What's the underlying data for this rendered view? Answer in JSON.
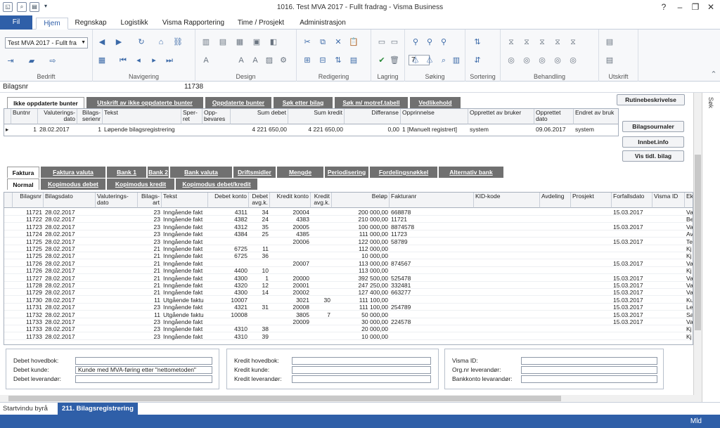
{
  "window": {
    "title": "1016. Test MVA 2017 - Fullt fradrag - Visma Business"
  },
  "ribbon_tabs": [
    "Fil",
    "Hjem",
    "Regnskap",
    "Logistikk",
    "Visma Rapportering",
    "Time / Prosjekt",
    "Administrasjon"
  ],
  "ribbon": {
    "company_select": "Test MVA 2017 - Fullt fra",
    "font_size": "7",
    "groups": [
      "Bedrift",
      "Navigering",
      "Design",
      "Redigering",
      "Lagring",
      "Søking",
      "Sortering",
      "Behandling",
      "Utskrift"
    ]
  },
  "bilagsnr": {
    "label": "Bilagsnr",
    "value": "11738"
  },
  "top_tabs": [
    "Ikke oppdaterte bunter",
    "Utskrift av ikke oppdaterte bunter",
    "Oppdaterte bunter",
    "Søk etter bilag",
    "Søk m/ motref.tabell",
    "Vedlikehold"
  ],
  "rutine_button": "Rutinebeskrivelse",
  "batch_grid": {
    "headers": [
      "Buntnr",
      "Valuterings-\ndato",
      "Bilags-\nserienr",
      "Tekst",
      "Sper-\nret",
      "Opp-\nbevares",
      "Sum debet",
      "Sum kredit",
      "Differanse",
      "Opprinnelse",
      "Opprettet av bruker",
      "Opprettet\ndato",
      "Endret av bruk"
    ],
    "row": [
      "1",
      "28.02.2017",
      "1",
      "Løpende bilagsregistrering",
      "",
      "",
      "4 221 650,00",
      "4 221 650,00",
      "0,00",
      "1 [Manuelt registrert]",
      "system",
      "09.06.2017",
      "system"
    ]
  },
  "side_buttons": [
    "Bilagsournaler",
    "Innbet.info",
    "Vis tidl. bilag"
  ],
  "mid_tabs": [
    "Faktura",
    "Faktura valuta",
    "Bank 1",
    "Bank 2",
    "Bank valuta",
    "Driftsmidler",
    "Mengde",
    "Periodisering",
    "Fordelingsnøkkel",
    "Alternativ bank"
  ],
  "sub_tabs": [
    "Normal",
    "Kopimodus debet",
    "Kopimodus kredit",
    "Kopimodus debet/kredit"
  ],
  "voucher_grid": {
    "headers": [
      "Bilagsnr",
      "Bilagsdato",
      "Valuterings-\ndato",
      "Bilags-\nart",
      "Tekst",
      "Debet konto",
      "Debet\navg.k.",
      "Kredit konto",
      "Kredit\navg.k.",
      "Beløp",
      "Fakturanr",
      "KID-kode",
      "Avdeling",
      "Prosjekt",
      "Forfallsdato",
      "Visma ID",
      "Ek"
    ],
    "rows": [
      [
        "11721",
        "28.02.2017",
        "",
        "23",
        "Inngående fakt",
        "4311",
        "34",
        "20004",
        "",
        "200 000,00",
        "668878",
        "",
        "",
        "",
        "15.03.2017",
        "",
        "Va"
      ],
      [
        "11722",
        "28.02.2017",
        "",
        "23",
        "Inngående fakt",
        "4382",
        "24",
        "4383",
        "",
        "210 000,00",
        "11721",
        "",
        "",
        "",
        "",
        "",
        "Be"
      ],
      [
        "11723",
        "28.02.2017",
        "",
        "23",
        "Inngående fakt",
        "4312",
        "35",
        "20005",
        "",
        "100 000,00",
        "8874578",
        "",
        "",
        "",
        "15.03.2017",
        "",
        "Va"
      ],
      [
        "11724",
        "28.02.2017",
        "",
        "23",
        "Inngående fakt",
        "4384",
        "25",
        "4385",
        "",
        "111 000,00",
        "11723",
        "",
        "",
        "",
        "",
        "",
        "Av"
      ],
      [
        "11725",
        "28.02.2017",
        "",
        "23",
        "Inngående fakt",
        "",
        "",
        "20006",
        "",
        "122 000,00",
        "58789",
        "",
        "",
        "",
        "15.03.2017",
        "",
        "Te"
      ],
      [
        "11725",
        "28.02.2017",
        "",
        "21",
        "Inngående fakt",
        "6725",
        "11",
        "",
        "",
        "112 000,00",
        "",
        "",
        "",
        "",
        "",
        "",
        "Kj"
      ],
      [
        "11725",
        "28.02.2017",
        "",
        "21",
        "Inngående fakt",
        "6725",
        "36",
        "",
        "",
        "10 000,00",
        "",
        "",
        "",
        "",
        "",
        "",
        "Kj"
      ],
      [
        "11726",
        "28.02.2017",
        "",
        "21",
        "Inngående fakt",
        "",
        "",
        "20007",
        "",
        "113 000,00",
        "874567",
        "",
        "",
        "",
        "15.03.2017",
        "",
        "Va"
      ],
      [
        "11726",
        "28.02.2017",
        "",
        "21",
        "Inngående fakt",
        "4400",
        "10",
        "",
        "",
        "113 000,00",
        "",
        "",
        "",
        "",
        "",
        "",
        "Kj"
      ],
      [
        "11727",
        "28.02.2017",
        "",
        "21",
        "Inngående fakt",
        "4300",
        "1",
        "20000",
        "",
        "392 500,00",
        "525478",
        "",
        "",
        "",
        "15.03.2017",
        "",
        "Va"
      ],
      [
        "11728",
        "28.02.2017",
        "",
        "21",
        "Inngående fakt",
        "4320",
        "12",
        "20001",
        "",
        "247 250,00",
        "332481",
        "",
        "",
        "",
        "15.03.2017",
        "",
        "Va"
      ],
      [
        "11729",
        "28.02.2017",
        "",
        "21",
        "Inngående fakt",
        "4300",
        "14",
        "20002",
        "",
        "127 400,00",
        "663277",
        "",
        "",
        "",
        "15.03.2017",
        "",
        "Va"
      ],
      [
        "11730",
        "28.02.2017",
        "",
        "11",
        "Utgående faktu",
        "10007",
        "",
        "3021",
        "30",
        "111 100,00",
        "",
        "",
        "",
        "",
        "15.03.2017",
        "",
        "Ku"
      ],
      [
        "11731",
        "28.02.2017",
        "",
        "23",
        "Inngående fakt",
        "4321",
        "31",
        "20008",
        "",
        "111 100,00",
        "254789",
        "",
        "",
        "",
        "15.03.2017",
        "",
        "Le"
      ],
      [
        "11732",
        "28.02.2017",
        "",
        "11",
        "Utgående faktu",
        "10008",
        "",
        "3805",
        "7",
        "50 000,00",
        "",
        "",
        "",
        "",
        "15.03.2017",
        "",
        "Sa"
      ],
      [
        "11733",
        "28.02.2017",
        "",
        "23",
        "Inngående fakt",
        "",
        "",
        "20009",
        "",
        "30 000,00",
        "224578",
        "",
        "",
        "",
        "15.03.2017",
        "",
        "Va"
      ],
      [
        "11733",
        "28.02.2017",
        "",
        "23",
        "Inngående fakt",
        "4310",
        "38",
        "",
        "",
        "20 000,00",
        "",
        "",
        "",
        "",
        "",
        "",
        "Kj"
      ],
      [
        "11733",
        "28.02.2017",
        "",
        "23",
        "Inngående fakt",
        "4310",
        "39",
        "",
        "",
        "10 000,00",
        "",
        "",
        "",
        "",
        "",
        "",
        "Kj"
      ]
    ]
  },
  "panel_left": {
    "labels": [
      "Debet hovedbok:",
      "Debet kunde:",
      "Debet leverandør:"
    ],
    "values": [
      "",
      "Kunde med MVA-føring etter \"nettometoden\"",
      ""
    ]
  },
  "panel_mid": {
    "labels": [
      "Kredit hovedbok:",
      "Kredit kunde:",
      "Kredit leverandør:"
    ],
    "values": [
      "",
      "",
      ""
    ]
  },
  "panel_right": {
    "labels": [
      "Visma ID:",
      "Org.nr leverandør:",
      "Bankkonto levarandør:"
    ],
    "values": [
      "",
      "",
      ""
    ]
  },
  "side_panel_label": "Søk",
  "doc_tabs": [
    "Startvindu byrå",
    "211. Bilagsregistrering"
  ],
  "status": {
    "right": "Mld"
  }
}
